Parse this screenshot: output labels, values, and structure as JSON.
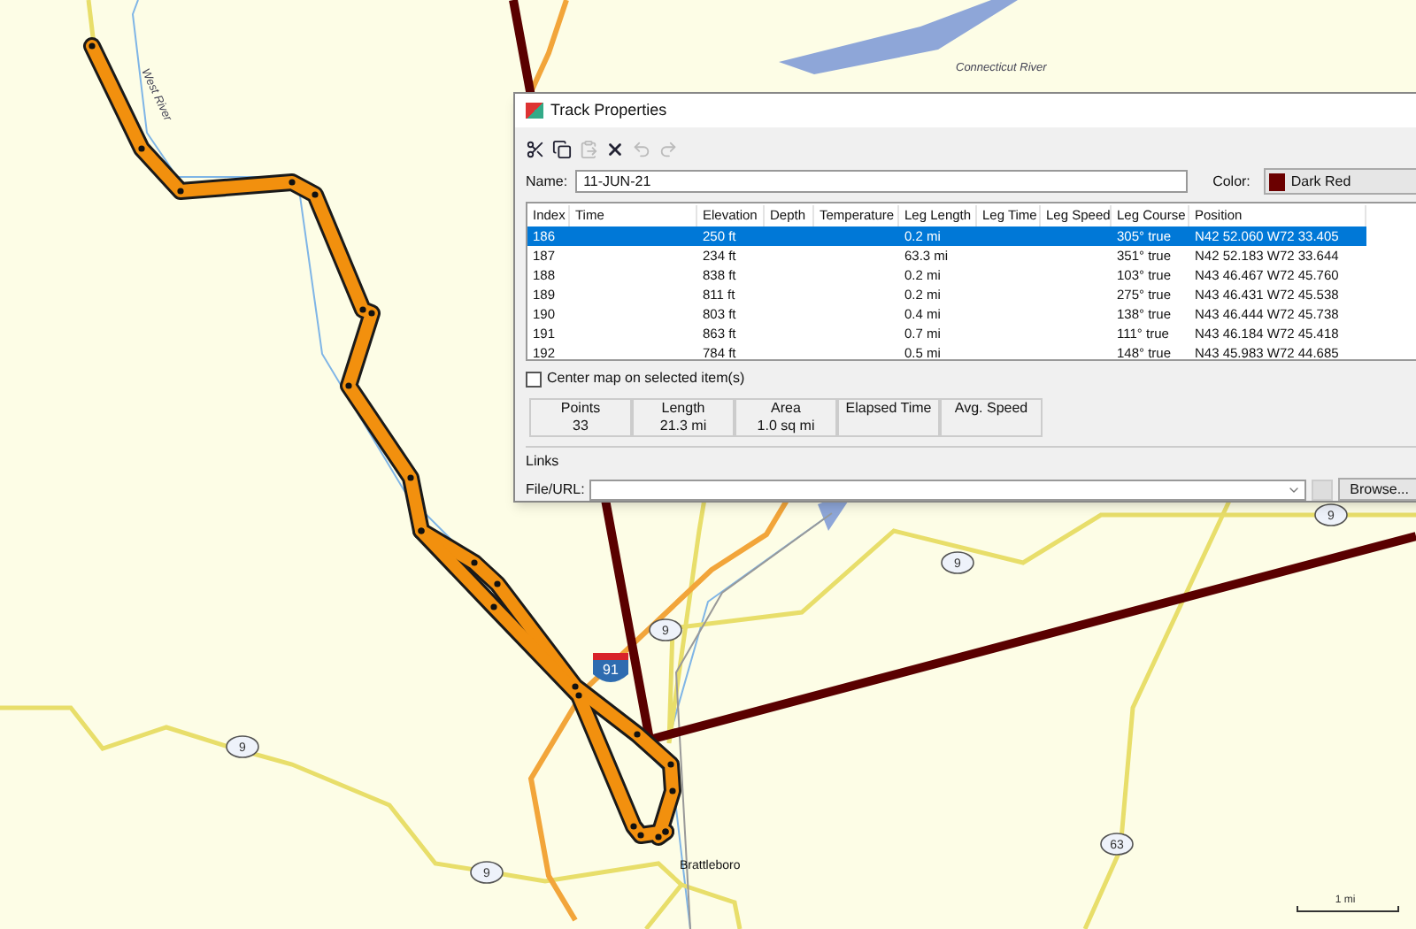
{
  "map": {
    "labels": [
      {
        "kind": "river",
        "text": "West River"
      },
      {
        "kind": "river",
        "text": "Connecticut River"
      },
      {
        "kind": "town",
        "text": "Brattleboro"
      }
    ],
    "shields": [
      {
        "kind": "state",
        "text": "9"
      },
      {
        "kind": "state",
        "text": "9"
      },
      {
        "kind": "state",
        "text": "9"
      },
      {
        "kind": "state",
        "text": "9"
      },
      {
        "kind": "state",
        "text": "9"
      },
      {
        "kind": "state",
        "text": "63"
      },
      {
        "kind": "interstate",
        "text": "91"
      }
    ],
    "scale": {
      "text": "1 mi"
    }
  },
  "dialog": {
    "title": "Track Properties",
    "toolbar": [
      {
        "kind": "cut",
        "disabled": false
      },
      {
        "kind": "copy",
        "disabled": false
      },
      {
        "kind": "paste",
        "disabled": true
      },
      {
        "kind": "delete",
        "disabled": false
      },
      {
        "kind": "undo",
        "disabled": true
      },
      {
        "kind": "redo",
        "disabled": true
      }
    ],
    "name": {
      "label": "Name:",
      "value": "11-JUN-21"
    },
    "color": {
      "label": "Color:",
      "value": "Dark Red",
      "color": "#6b0000"
    },
    "table": {
      "columns": [
        "Index",
        "Time",
        "Elevation",
        "Depth",
        "Temperature",
        "Leg Length",
        "Leg Time",
        "Leg Speed",
        "Leg Course",
        "Position"
      ],
      "rows": [
        {
          "selected": true,
          "cells": [
            "186",
            "",
            "250 ft",
            "",
            "",
            "0.2 mi",
            "",
            "",
            "305° true",
            "N42 52.060 W72 33.405"
          ]
        },
        {
          "selected": false,
          "cells": [
            "187",
            "",
            "234 ft",
            "",
            "",
            "63.3 mi",
            "",
            "",
            "351° true",
            "N42 52.183 W72 33.644"
          ]
        },
        {
          "selected": false,
          "cells": [
            "188",
            "",
            "838 ft",
            "",
            "",
            "0.2 mi",
            "",
            "",
            "103° true",
            "N43 46.467 W72 45.760"
          ]
        },
        {
          "selected": false,
          "cells": [
            "189",
            "",
            "811 ft",
            "",
            "",
            "0.2 mi",
            "",
            "",
            "275° true",
            "N43 46.431 W72 45.538"
          ]
        },
        {
          "selected": false,
          "cells": [
            "190",
            "",
            "803 ft",
            "",
            "",
            "0.4 mi",
            "",
            "",
            "138° true",
            "N43 46.444 W72 45.738"
          ]
        },
        {
          "selected": false,
          "cells": [
            "191",
            "",
            "863 ft",
            "",
            "",
            "0.7 mi",
            "",
            "",
            "111° true",
            "N43 46.184 W72 45.418"
          ]
        },
        {
          "selected": false,
          "cells": [
            "192",
            "",
            "784 ft",
            "",
            "",
            "0.5 mi",
            "",
            "",
            "148° true",
            "N43 45.983 W72 44.685"
          ]
        }
      ]
    },
    "center_checkbox": {
      "label": "Center map on selected item(s)",
      "checked": false
    },
    "stats": [
      {
        "label": "Points",
        "value": "33"
      },
      {
        "label": "Length",
        "value": "21.3 mi"
      },
      {
        "label": "Area",
        "value": "1.0 sq mi"
      },
      {
        "label": "Elapsed Time"
      },
      {
        "label": "Avg. Speed"
      }
    ],
    "links": {
      "title": "Links",
      "label": "File/URL:",
      "browse": "Browse..."
    }
  }
}
